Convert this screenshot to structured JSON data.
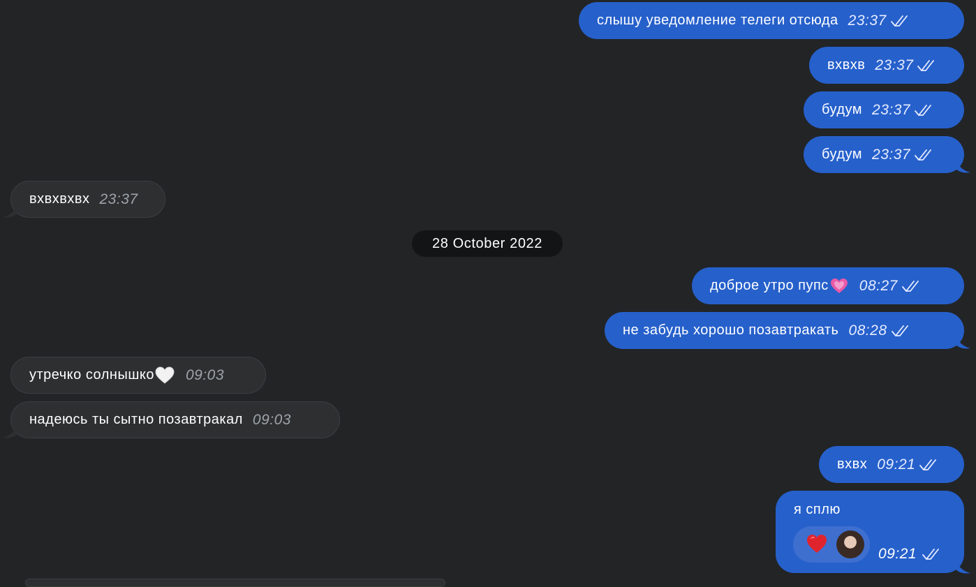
{
  "messages": [
    {
      "text": "слышу уведомление телеги отсюда",
      "time": "23:37",
      "dir": "out"
    },
    {
      "text": "вхвхв",
      "time": "23:37",
      "dir": "out"
    },
    {
      "text": "будум",
      "time": "23:37",
      "dir": "out"
    },
    {
      "text": "будум",
      "time": "23:37",
      "dir": "out"
    },
    {
      "text": "вхвхвхвх",
      "time": "23:37",
      "dir": "in"
    },
    {
      "text": "доброе утро пупс",
      "time": "08:27",
      "dir": "out",
      "emoji": "pink-sparkling-heart"
    },
    {
      "text": "не забудь хорошо позавтракать",
      "time": "08:28",
      "dir": "out"
    },
    {
      "text": "утречко солнышко",
      "time": "09:03",
      "dir": "in",
      "emoji": "white-heart"
    },
    {
      "text": "надеюсь ты сытно позавтракал",
      "time": "09:03",
      "dir": "in"
    },
    {
      "text": "вхвх",
      "time": "09:21",
      "dir": "out"
    },
    {
      "text": "я сплю",
      "time": "09:21",
      "dir": "out",
      "reaction": "red-heart"
    }
  ],
  "date_separator": "28 October 2022",
  "colors": {
    "background": "#222426",
    "outgoing_bubble": "#2660cb",
    "incoming_bubble": "#2d2f31",
    "date_pill": "#121415"
  },
  "icons": {
    "read_receipt": "double-check-icon",
    "reaction": "red-heart-icon",
    "reactor": "user-avatar"
  }
}
